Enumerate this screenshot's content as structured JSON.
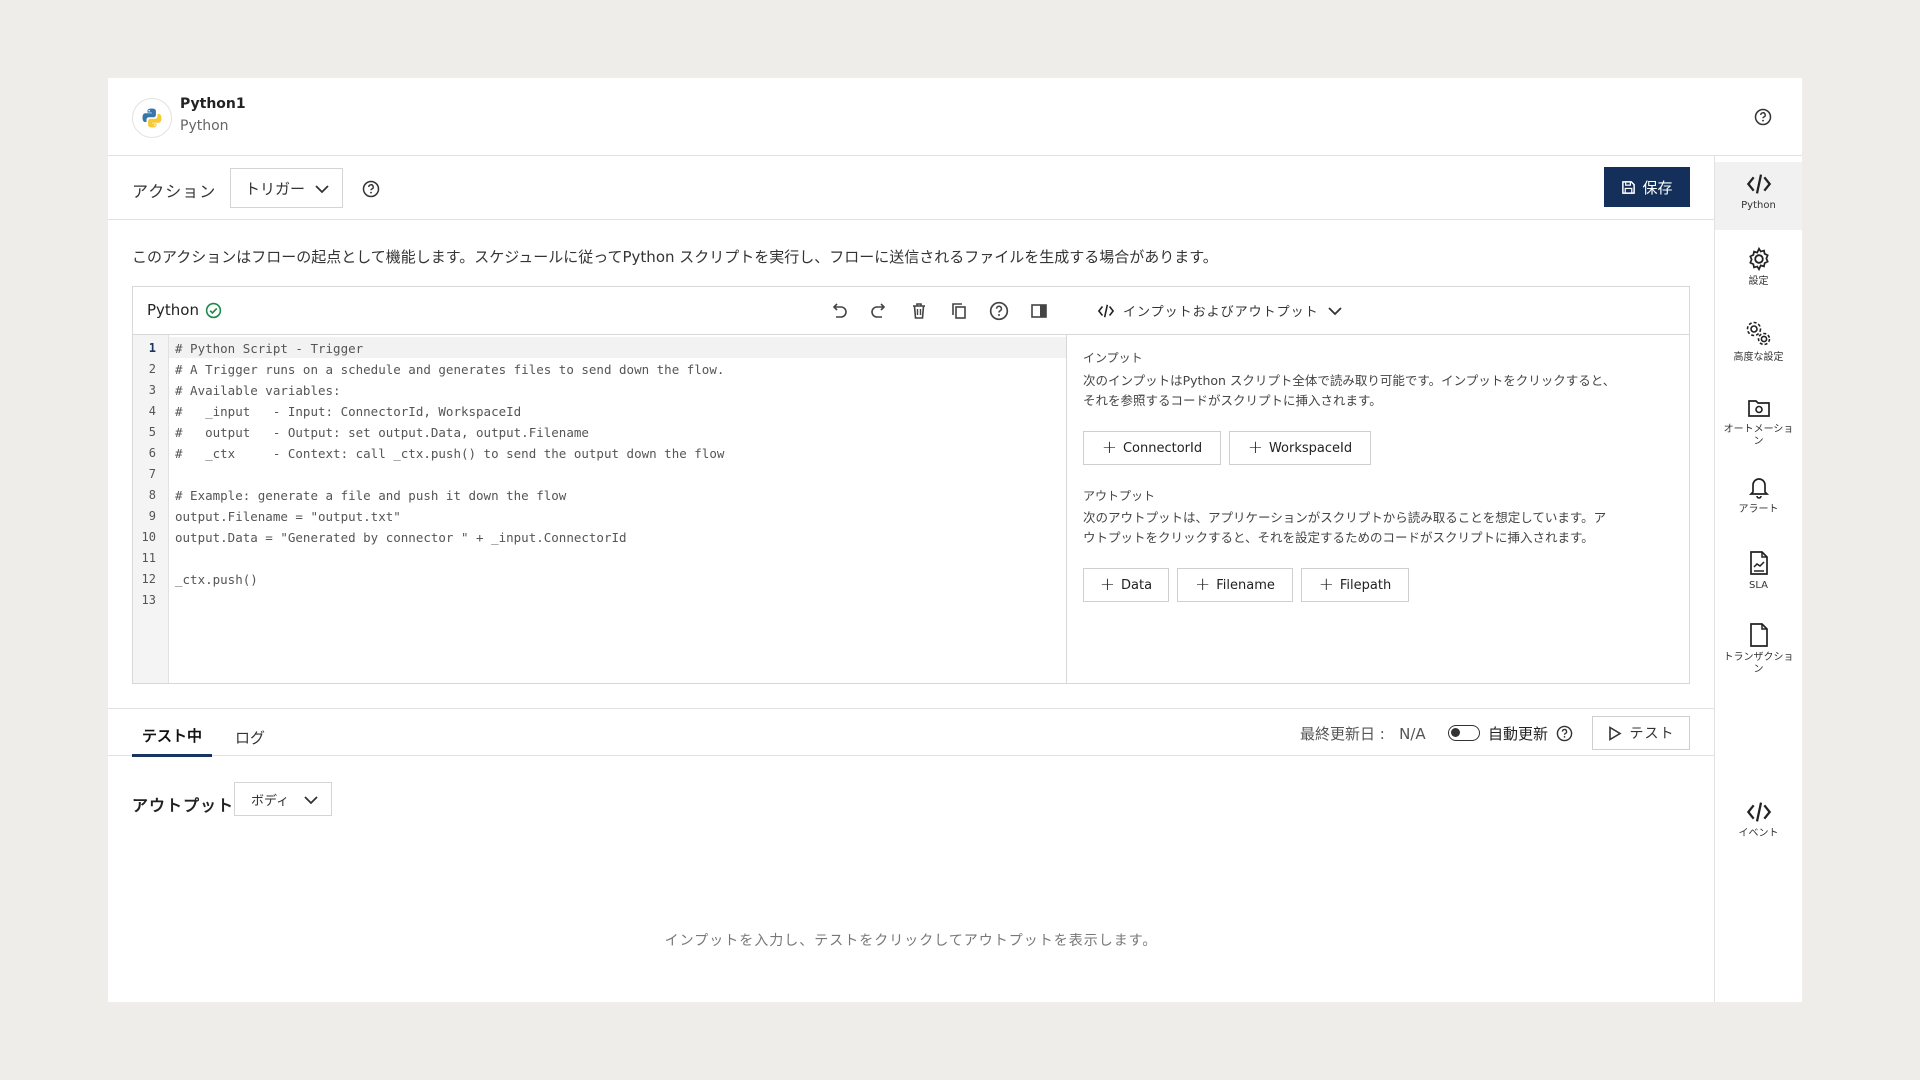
{
  "header": {
    "name": "Python1",
    "subtitle": "Python"
  },
  "action": {
    "label": "アクション",
    "selected": "トリガー"
  },
  "toolbar": {
    "save_label": "保存"
  },
  "description": "このアクションはフローの起点として機能します。スケジュールに従ってPython スクリプトを実行し、フローに送信されるファイルを生成する場合があります。",
  "editor": {
    "title": "Python",
    "status": "valid",
    "current_line": 1,
    "lines": [
      "# Python Script - Trigger",
      "# A Trigger runs on a schedule and generates files to send down the flow.",
      "# Available variables:",
      "#   _input   - Input: ConnectorId, WorkspaceId",
      "#   output   - Output: set output.Data, output.Filename",
      "#   _ctx     - Context: call _ctx.push() to send the output down the flow",
      "",
      "# Example: generate a file and push it down the flow",
      "output.Filename = \"output.txt\"",
      "output.Data = \"Generated by connector \" + _input.ConnectorId",
      "",
      "_ctx.push()",
      ""
    ],
    "line_numbers": [
      "1",
      "2",
      "3",
      "4",
      "5",
      "6",
      "7",
      "8",
      "9",
      "10",
      "11",
      "12",
      "13"
    ]
  },
  "io": {
    "title": "インプットおよびアウトプット",
    "inputs_heading": "インプット",
    "inputs_desc_1": "次のインプットはPython スクリプト全体で読み取り可能です。インプットをクリックすると、",
    "inputs_desc_2": "それを参照するコードがスクリプトに挿入されます。",
    "inputs": [
      "ConnectorId",
      "WorkspaceId"
    ],
    "outputs_heading": "アウトプット",
    "outputs_desc_1": "次のアウトプットは、アプリケーションがスクリプトから読み取ることを想定しています。ア",
    "outputs_desc_2": "ウトプットをクリックすると、それを設定するためのコードがスクリプトに挿入されます。",
    "outputs": [
      "Data",
      "Filename",
      "Filepath"
    ]
  },
  "tabs": [
    {
      "label": "テスト中",
      "active": true
    },
    {
      "label": "ログ",
      "active": false
    }
  ],
  "test_bar": {
    "last_updated_label": "最終更新日 :",
    "last_updated_value": "N/A",
    "auto_refresh_label": "自動更新",
    "auto_refresh_on": false,
    "test_button": "テスト"
  },
  "output": {
    "label": "アウトプット",
    "selected": "ボディ",
    "empty_message": "インプットを入力し、テストをクリックしてアウトプットを表示します。"
  },
  "rail": [
    {
      "label": "Python",
      "icon": "code-icon",
      "active": true
    },
    {
      "label": "設定",
      "icon": "gear-icon",
      "active": false
    },
    {
      "label": "高度な設定",
      "icon": "gears-icon",
      "active": false
    },
    {
      "label": "オートメーション",
      "icon": "camera-folder-icon",
      "active": false
    },
    {
      "label": "アラート",
      "icon": "bell-icon",
      "active": false
    },
    {
      "label": "SLA",
      "icon": "sla-document-icon",
      "active": false
    },
    {
      "label": "トランザクション",
      "icon": "document-icon",
      "active": false
    },
    {
      "label": "イベント",
      "icon": "code-icon",
      "active": false
    }
  ],
  "colors": {
    "brand": "#14305a",
    "success": "#1e8a4c",
    "background": "#efede9"
  }
}
